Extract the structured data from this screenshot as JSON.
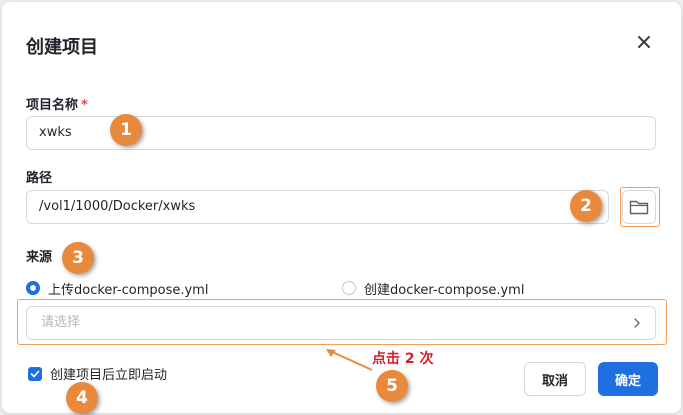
{
  "dialog": {
    "title": "创建项目"
  },
  "fields": {
    "name_label": "项目名称",
    "required_mark": "*",
    "name_value": "xwks",
    "path_label": "路径",
    "path_value": "/vol1/1000/Docker/xwks",
    "source_label": "来源"
  },
  "source_options": {
    "upload_label": "上传docker-compose.yml",
    "upload_checked": true,
    "create_label": "创建docker-compose.yml",
    "create_checked": false
  },
  "select": {
    "placeholder": "请选择"
  },
  "start_option": {
    "label": "创建项目后立即启动",
    "checked": true
  },
  "buttons": {
    "cancel": "取消",
    "confirm": "确定"
  },
  "annotations": {
    "steps": [
      "1",
      "2",
      "3",
      "4",
      "5"
    ],
    "click_hint": "点击 2 次",
    "color": "#e8893b"
  },
  "colors": {
    "accent": "#1f6fe0",
    "required": "#e5484d",
    "hint_text": "#d0202b"
  },
  "icons": {
    "close": "close-icon",
    "folder": "folder-icon",
    "chevron": "chevron-right-icon",
    "check": "check-icon"
  }
}
